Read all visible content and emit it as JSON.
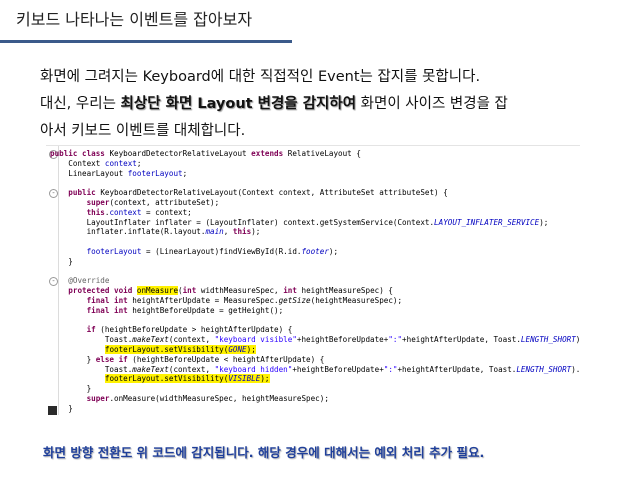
{
  "page": {
    "title": "키보드 나타나는 이벤트를 잡아보자"
  },
  "body": {
    "line1": "화면에 그려지는 Keyboard에 대한 직접적인 Event는 잡지를 못합니다.",
    "line2_prefix": "대신, 우리는 ",
    "line2_emph": "최상단 화면 Layout 변경을 감지하여",
    "line2_suffix": " 화면이 사이즈 변경을 잡",
    "line3": "아서 키보드 이벤트를 대체합니다."
  },
  "code": {
    "lines": [
      [
        {
          "t": "public class ",
          "c": "kw"
        },
        {
          "t": "KeyboardDetectorRelativeLayout "
        },
        {
          "t": "extends ",
          "c": "kw"
        },
        {
          "t": "RelativeLayout {"
        }
      ],
      [
        {
          "t": "    Context "
        },
        {
          "t": "context",
          "c": "fld"
        },
        {
          "t": ";"
        }
      ],
      [
        {
          "t": "    LinearLayout "
        },
        {
          "t": "footerLayout",
          "c": "fld"
        },
        {
          "t": ";"
        }
      ],
      [
        {
          "t": ""
        }
      ],
      [
        {
          "t": "    "
        },
        {
          "t": "public ",
          "c": "kw"
        },
        {
          "t": "KeyboardDetectorRelativeLayout(Context context, AttributeSet attributeSet) {"
        }
      ],
      [
        {
          "t": "        "
        },
        {
          "t": "super",
          "c": "kw"
        },
        {
          "t": "(context, attributeSet);"
        }
      ],
      [
        {
          "t": "        "
        },
        {
          "t": "this",
          "c": "kw"
        },
        {
          "t": "."
        },
        {
          "t": "context",
          "c": "fld"
        },
        {
          "t": " = context;"
        }
      ],
      [
        {
          "t": "        LayoutInflater inflater = (LayoutInflater) context.getSystemService(Context."
        },
        {
          "t": "LAYOUT_INFLATER_SERVICE",
          "c": "itfld"
        },
        {
          "t": ");"
        }
      ],
      [
        {
          "t": "        inflater.inflate(R.layout."
        },
        {
          "t": "main",
          "c": "itfld"
        },
        {
          "t": ", "
        },
        {
          "t": "this",
          "c": "kw"
        },
        {
          "t": ");"
        }
      ],
      [
        {
          "t": ""
        }
      ],
      [
        {
          "t": "        "
        },
        {
          "t": "footerLayout",
          "c": "fld"
        },
        {
          "t": " = (LinearLayout)findViewById(R.id."
        },
        {
          "t": "footer",
          "c": "itfld"
        },
        {
          "t": ");"
        }
      ],
      [
        {
          "t": "    }"
        }
      ],
      [
        {
          "t": ""
        }
      ],
      [
        {
          "t": "    "
        },
        {
          "t": "@Override",
          "c": "ann"
        }
      ],
      [
        {
          "t": "    "
        },
        {
          "t": "protected void ",
          "c": "kw"
        },
        {
          "t": "onMeasure",
          "c": "hl"
        },
        {
          "t": "("
        },
        {
          "t": "int ",
          "c": "kw"
        },
        {
          "t": "widthMeasureSpec, "
        },
        {
          "t": "int ",
          "c": "kw"
        },
        {
          "t": "heightMeasureSpec) {"
        }
      ],
      [
        {
          "t": "        "
        },
        {
          "t": "final int ",
          "c": "kw"
        },
        {
          "t": "heightAfterUpdate = MeasureSpec."
        },
        {
          "t": "getSize",
          "c": "it"
        },
        {
          "t": "(heightMeasureSpec);"
        }
      ],
      [
        {
          "t": "        "
        },
        {
          "t": "final int ",
          "c": "kw"
        },
        {
          "t": "heightBeforeUpdate = getHeight();"
        }
      ],
      [
        {
          "t": ""
        }
      ],
      [
        {
          "t": "        "
        },
        {
          "t": "if ",
          "c": "kw"
        },
        {
          "t": "(heightBeforeUpdate > heightAfterUpdate) {"
        }
      ],
      [
        {
          "t": "            Toast."
        },
        {
          "t": "makeText",
          "c": "it"
        },
        {
          "t": "(context, "
        },
        {
          "t": "\"keyboard visible\"",
          "c": "str"
        },
        {
          "t": "+heightBeforeUpdate+"
        },
        {
          "t": "\":\"",
          "c": "str"
        },
        {
          "t": "+heightAfterUpdate, Toast."
        },
        {
          "t": "LENGTH_SHORT",
          "c": "itfld"
        },
        {
          "t": ").show();"
        }
      ],
      [
        {
          "t": "            "
        },
        {
          "t": "footerLayout.setVisibility(",
          "c": "hl"
        },
        {
          "t": "GONE",
          "c": "itfld hl"
        },
        {
          "t": ");",
          "c": "hl"
        }
      ],
      [
        {
          "t": "        } "
        },
        {
          "t": "else if ",
          "c": "kw"
        },
        {
          "t": "(heightBeforeUpdate < heightAfterUpdate) {"
        }
      ],
      [
        {
          "t": "            Toast."
        },
        {
          "t": "makeText",
          "c": "it"
        },
        {
          "t": "(context, "
        },
        {
          "t": "\"keyboard hidden\"",
          "c": "str"
        },
        {
          "t": "+heightBeforeUpdate+"
        },
        {
          "t": "\":\"",
          "c": "str"
        },
        {
          "t": "+heightAfterUpdate, Toast."
        },
        {
          "t": "LENGTH_SHORT",
          "c": "itfld"
        },
        {
          "t": ").show();"
        }
      ],
      [
        {
          "t": "            "
        },
        {
          "t": "footerLayout.setVisibility(",
          "c": "hl"
        },
        {
          "t": "VISIBLE",
          "c": "itfld hl"
        },
        {
          "t": ");",
          "c": "hl"
        }
      ],
      [
        {
          "t": "        }"
        }
      ],
      [
        {
          "t": "        "
        },
        {
          "t": "super",
          "c": "kw"
        },
        {
          "t": ".onMeasure(widthMeasureSpec, heightMeasureSpec);"
        }
      ],
      [
        {
          "t": "    }"
        }
      ],
      [
        {
          "t": ""
        }
      ],
      [
        {
          "t": "}"
        }
      ]
    ]
  },
  "footer": {
    "note": "화면 방향 전환도 위 코드에 감지됩니다. 해당 경우에 대해서는 예외 처리 추가 필요."
  },
  "colors": {
    "title_rule": "#3b5a8a",
    "keyword": "#7f0055",
    "field": "#0000c0",
    "string": "#2a00ff",
    "highlight": "#fff200",
    "note": "#1f3f9a"
  }
}
